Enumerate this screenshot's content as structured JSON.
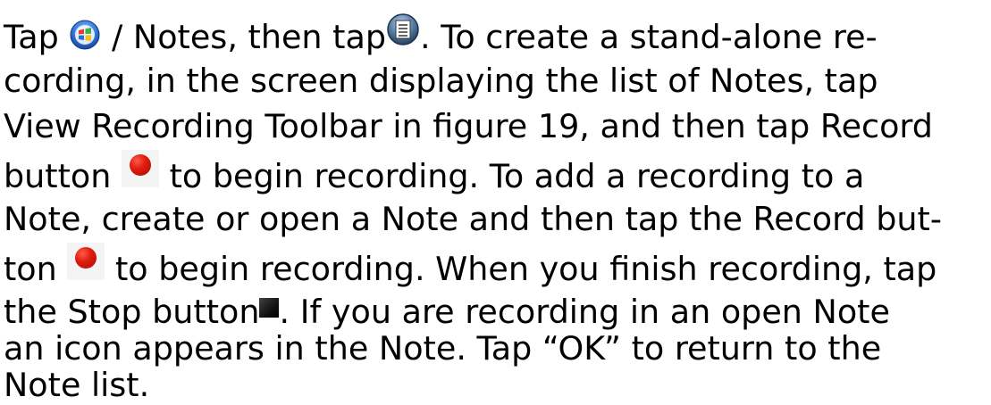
{
  "paragraph": {
    "l1a": "Tap ",
    "l1b": " / Notes, then tap",
    "l1c": ". To create a stand-alone re-",
    "l2": "cording, in the screen displaying the list of Notes, tap",
    "l3": "View Recording Toolbar in figure 19, and then tap Record",
    "l4a": "button ",
    "l4b": " to begin recording. To add a recording to a",
    "l5": "Note, create or open a Note and then tap the Record but-",
    "l6a": "ton ",
    "l6b": " to begin recording. When you finish recording, tap",
    "l7a": "the Stop button",
    "l7b": ". If you are recording in an open Note",
    "l8": "an icon appears in the Note. Tap “OK” to return to the",
    "l9": "Note list."
  },
  "icons": {
    "start": "windows-start-icon",
    "menu": "menu-icon",
    "record": "record-icon",
    "stop": "stop-icon"
  },
  "colors": {
    "record": "#e01e10",
    "start_blue": "#2a6fd6",
    "text": "#000000"
  }
}
